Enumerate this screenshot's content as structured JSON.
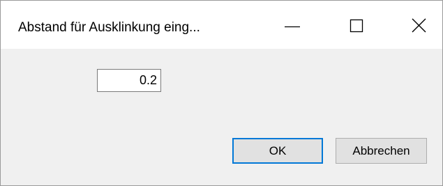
{
  "window": {
    "title": "Abstand für Ausklinkung eing..."
  },
  "caption_buttons": {
    "minimize_icon": "minimize-icon",
    "maximize_icon": "maximize-icon",
    "close_icon": "close-icon"
  },
  "form": {
    "value": "0.2"
  },
  "buttons": {
    "ok_label": "OK",
    "cancel_label": "Abbrechen"
  },
  "colors": {
    "accent": "#0078d7",
    "dialog_background": "#f0f0f0",
    "titlebar_background": "#ffffff"
  }
}
